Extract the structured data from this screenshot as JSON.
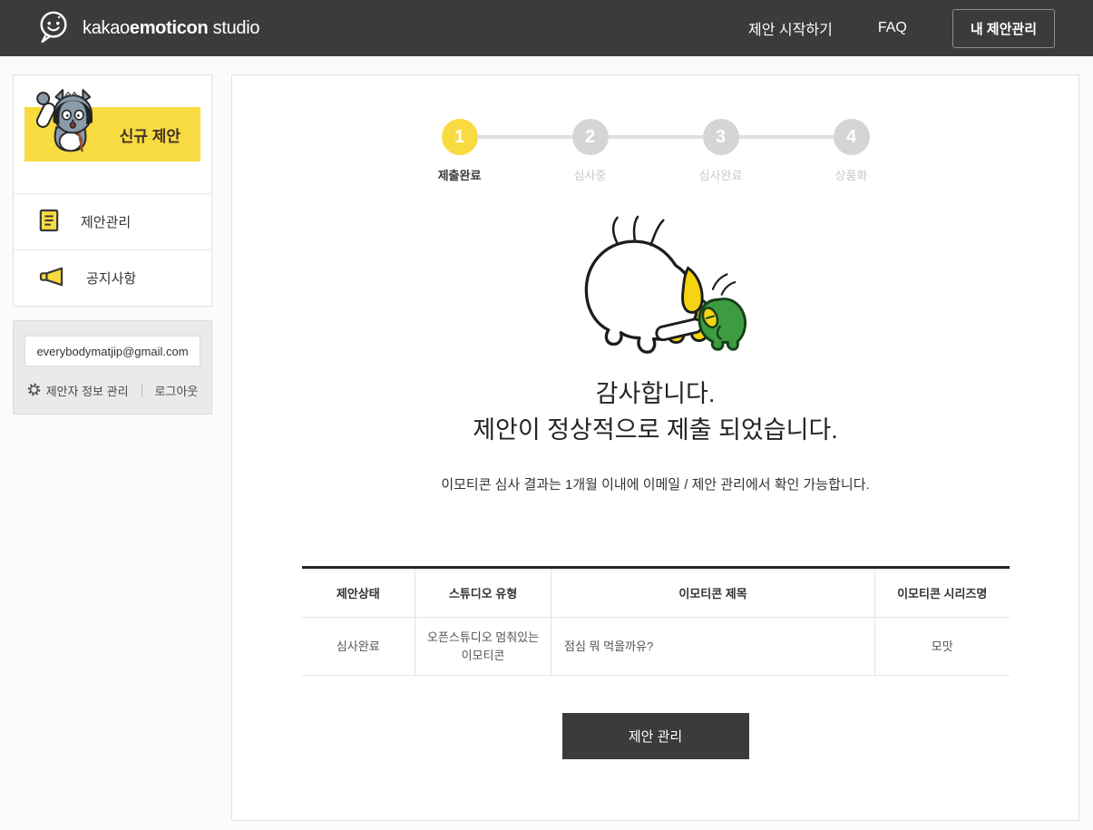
{
  "header": {
    "brand_regular": "kakao",
    "brand_bold": "emoticon",
    "brand_suffix": "studio",
    "nav": {
      "start_label": "제안 시작하기",
      "faq_label": "FAQ",
      "my_proposals_label": "내 제안관리"
    }
  },
  "sidebar": {
    "new_proposal_label": "신규 제안",
    "menu": [
      {
        "label": "제안관리",
        "icon": "document-icon"
      },
      {
        "label": "공지사항",
        "icon": "megaphone-icon"
      }
    ],
    "account": {
      "email": "everybodymatjip@gmail.com",
      "manage_label": "제안자 정보 관리",
      "logout_label": "로그아웃"
    }
  },
  "main": {
    "steps": [
      {
        "number": "1",
        "label": "제출완료",
        "active": true
      },
      {
        "number": "2",
        "label": "심사중",
        "active": false
      },
      {
        "number": "3",
        "label": "심사완료",
        "active": false
      },
      {
        "number": "4",
        "label": "상품화",
        "active": false
      }
    ],
    "thanks_line1": "감사합니다.",
    "thanks_line2": "제안이 정상적으로 제출 되었습니다.",
    "notice": "이모티콘 심사 결과는 1개월 이내에 이메일 / 제안 관리에서 확인 가능합니다.",
    "table": {
      "headers": [
        "제안상태",
        "스튜디오 유형",
        "이모티콘 제목",
        "이모티콘 시리즈명"
      ],
      "rows": [
        [
          "심사완료",
          "오픈스튜디오 멈춰있는 이모티콘",
          "점심 뭐 먹을까유?",
          "모맛"
        ]
      ]
    },
    "manage_button_label": "제안 관리"
  },
  "colors": {
    "accent_yellow": "#F8DB40",
    "header_dark": "#3B3B3E",
    "step_inactive": "#D5D5D5",
    "table_top_border": "#262626",
    "character_green": "#3E9C40"
  }
}
